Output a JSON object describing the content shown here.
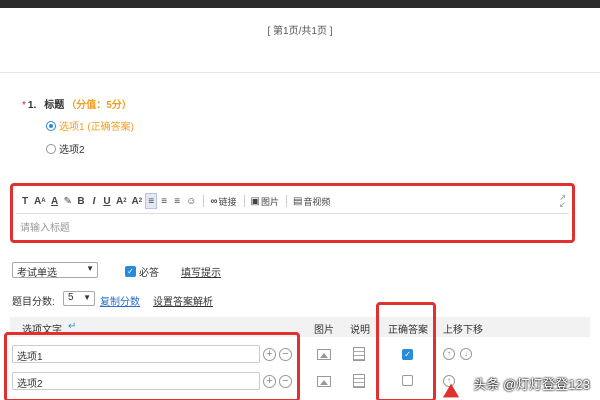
{
  "pagination": {
    "text": "[ 第1页/共1页 ]"
  },
  "question": {
    "required_mark": "*",
    "number": "1.",
    "title": "标题",
    "score_text": "（分值：5分）",
    "options": [
      {
        "label": "选项1 (正确答案)",
        "selected": true
      },
      {
        "label": "选项2",
        "selected": false
      }
    ]
  },
  "editor": {
    "toolbar": {
      "link_label": "链接",
      "image_label": "图片",
      "audio_video_label": "音视频"
    },
    "placeholder": "请输入标题"
  },
  "settings": {
    "question_type": "考试单选",
    "required_label": "必答",
    "required_checked": true,
    "fill_hint_label": "填写提示",
    "score_label": "题目分数:",
    "score_value": "5",
    "copy_score_label": "复制分数",
    "answer_analysis_label": "设置答案解析"
  },
  "table": {
    "headers": {
      "option_text": "选项文字",
      "image": "图片",
      "description": "说明",
      "correct_answer": "正确答案",
      "move": "上移下移"
    },
    "rows": [
      {
        "value": "选项1",
        "correct": true
      },
      {
        "value": "选项2",
        "correct": false
      }
    ]
  },
  "watermark": "头条 @灯灯登登123",
  "colors": {
    "accent": "#2a8bd8",
    "score": "#f0a020",
    "annotation": "#e03030",
    "link": "#2a6ecf"
  }
}
